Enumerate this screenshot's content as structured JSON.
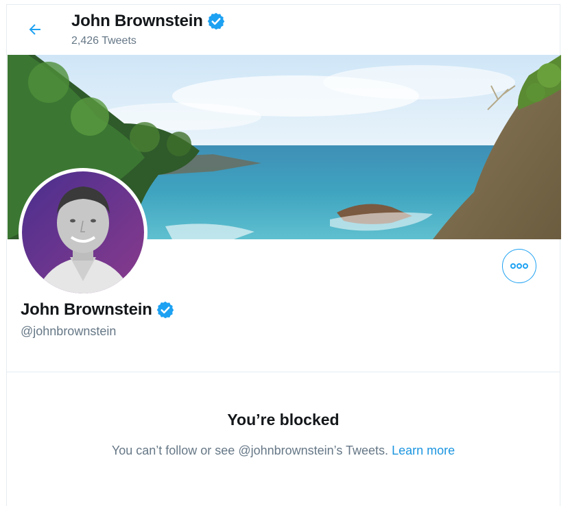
{
  "header": {
    "back_label": "Back",
    "name": "John Brownstein",
    "tweet_count": "2,426 Tweets"
  },
  "profile": {
    "name": "John Brownstein",
    "handle": "@johnbrownstein",
    "more_label": "More"
  },
  "blocked": {
    "title": "You’re blocked",
    "message": "You can’t follow or see @johnbrownstein’s Tweets.",
    "learn_more": "Learn more"
  },
  "colors": {
    "accent": "#1da1f2",
    "verified": "#1da1f2",
    "secondary_text": "#657786",
    "primary_text": "#14171a"
  },
  "icons": {
    "back": "arrow-left-icon",
    "verified": "verified-badge-icon",
    "more": "more-horizontal-icon"
  }
}
